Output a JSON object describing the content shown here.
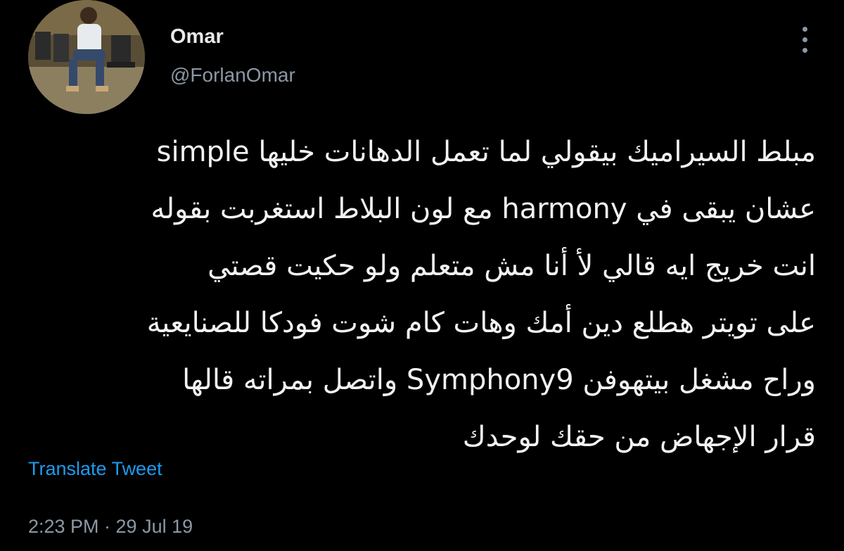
{
  "author": {
    "display_name": "Omar",
    "handle": "@ForlanOmar",
    "avatar_icon": "profile-photo"
  },
  "header": {
    "more_icon": "vertical-ellipsis-icon"
  },
  "tweet": {
    "lines": [
      "مبلط السيراميك بيقولي لما تعمل الدهانات خليها simple",
      "عشان يبقى في harmony مع لون البلاط استغربت بقوله",
      "انت خريج ايه قالي لأ أنا مش متعلم ولو حكيت قصتي",
      "على تويتر هطلع دين أمك وهات كام شوت فودكا للصنايعية",
      "وراح مشغل بيتهوفن Symphony9 واتصل بمراته قالها",
      "قرار الإجهاض من حقك لوحدك"
    ]
  },
  "actions": {
    "translate_label": "Translate Tweet"
  },
  "meta": {
    "timestamp": "2:23 PM · 29 Jul 19"
  },
  "colors": {
    "background": "#000000",
    "text": "#e7e9ea",
    "muted": "#8b98a5",
    "link": "#1d9bf0"
  }
}
